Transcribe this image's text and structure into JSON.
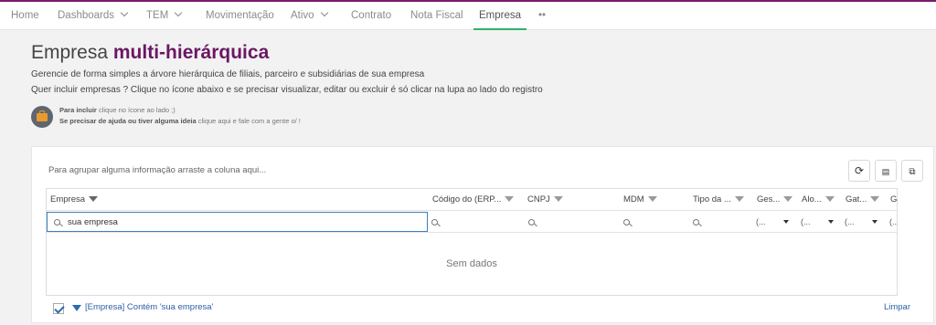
{
  "nav": {
    "items": [
      {
        "label": "Home"
      },
      {
        "label": "Dashboards"
      },
      {
        "label": "TEM"
      },
      {
        "label": "Movimentação"
      },
      {
        "label": "Ativo"
      },
      {
        "label": "Contrato"
      },
      {
        "label": "Nota Fiscal"
      },
      {
        "label": "Empresa"
      },
      {
        "label": "••"
      }
    ],
    "active": "Empresa"
  },
  "header": {
    "title_plain": "Empresa",
    "title_accent": "multi-hierárquica",
    "description_1": "Gerencie de forma simples a árvore hierárquica de filiais, parceiro e subsidiárias de sua empresa",
    "description_2": "Quer incluir empresas ? Clique no ícone abaixo e se precisar visualizar, editar ou excluir é só clicar na lupa ao lado do registro"
  },
  "help": {
    "line1_bold": "Para incluir",
    "line1_rest": " clique no ícone ao lado ;)",
    "line2_bold": "Se precisar de ajuda ou tiver alguma ideia",
    "line2_rest": " clique aqui e fale com a gente o/ !"
  },
  "grid": {
    "group_hint": "Para agrupar alguma informação arraste a coluna aqui...",
    "columns": [
      {
        "label": "Empresa"
      },
      {
        "label": "Código do (ERP..."
      },
      {
        "label": "CNPJ"
      },
      {
        "label": "MDM"
      },
      {
        "label": "Tipo da ..."
      },
      {
        "label": "Ges..."
      },
      {
        "label": "Alo..."
      },
      {
        "label": "Gat..."
      },
      {
        "label": "Gat"
      }
    ],
    "search_value": "sua empresa",
    "select_placeholder": "(...",
    "empty_text": "Sem dados",
    "active_filter": "[Empresa] Contém 'sua empresa'",
    "clear_label": "Limpar"
  },
  "colors": {
    "brand": "#6b1763",
    "active_tab": "#2fb36b",
    "link": "#2b5fa6"
  }
}
